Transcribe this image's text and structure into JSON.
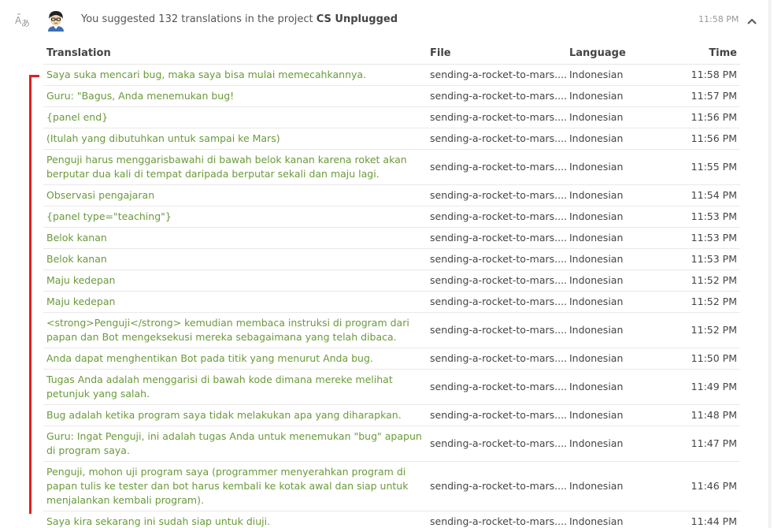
{
  "header": {
    "activity_prefix": "You suggested 132 translations in the project ",
    "project_name": "CS Unplugged",
    "time": "11:58 PM"
  },
  "icons": {
    "activity_type": "translate-icon",
    "user": "avatar-icon",
    "collapse": "chevron-up-icon"
  },
  "colors": {
    "translation_text": "#6a9a3a",
    "timeline_marker": "#e0201c"
  },
  "table": {
    "columns": {
      "translation": "Translation",
      "file": "File",
      "language": "Language",
      "time": "Time"
    },
    "rows": [
      {
        "translation": "Saya suka mencari bug, maka saya bisa mulai memecahkannya.",
        "file": "sending-a-rocket-to-mars....",
        "language": "Indonesian",
        "time": "11:58 PM",
        "lines": 1
      },
      {
        "translation": "Guru: \"Bagus, Anda menemukan bug!",
        "file": "sending-a-rocket-to-mars....",
        "language": "Indonesian",
        "time": "11:57 PM",
        "lines": 1
      },
      {
        "translation": "{panel end}",
        "file": "sending-a-rocket-to-mars....",
        "language": "Indonesian",
        "time": "11:56 PM",
        "lines": 1
      },
      {
        "translation": "(Itulah yang dibutuhkan untuk sampai ke Mars)",
        "file": "sending-a-rocket-to-mars....",
        "language": "Indonesian",
        "time": "11:56 PM",
        "lines": 1
      },
      {
        "translation": "Penguji harus menggarisbawahi di bawah belok kanan karena roket akan berputar dua kali di tempat daripada berputar sekali dan maju lagi.",
        "file": "sending-a-rocket-to-mars....",
        "language": "Indonesian",
        "time": "11:55 PM",
        "lines": 2
      },
      {
        "translation": "Observasi pengajaran",
        "file": "sending-a-rocket-to-mars....",
        "language": "Indonesian",
        "time": "11:54 PM",
        "lines": 1
      },
      {
        "translation": "{panel type=\"teaching\"}",
        "file": "sending-a-rocket-to-mars....",
        "language": "Indonesian",
        "time": "11:53 PM",
        "lines": 1
      },
      {
        "translation": "Belok kanan",
        "file": "sending-a-rocket-to-mars....",
        "language": "Indonesian",
        "time": "11:53 PM",
        "lines": 1
      },
      {
        "translation": "Belok kanan",
        "file": "sending-a-rocket-to-mars....",
        "language": "Indonesian",
        "time": "11:53 PM",
        "lines": 1
      },
      {
        "translation": "Maju kedepan",
        "file": "sending-a-rocket-to-mars....",
        "language": "Indonesian",
        "time": "11:52 PM",
        "lines": 1
      },
      {
        "translation": "Maju kedepan",
        "file": "sending-a-rocket-to-mars....",
        "language": "Indonesian",
        "time": "11:52 PM",
        "lines": 1
      },
      {
        "translation": "<strong>Penguji</strong> kemudian membaca instruksi di program dari papan dan Bot mengeksekusi mereka sebagaimana yang telah dibaca.",
        "file": "sending-a-rocket-to-mars....",
        "language": "Indonesian",
        "time": "11:52 PM",
        "lines": 2
      },
      {
        "translation": "Anda dapat menghentikan Bot pada titik yang menurut Anda bug.",
        "file": "sending-a-rocket-to-mars....",
        "language": "Indonesian",
        "time": "11:50 PM",
        "lines": 1
      },
      {
        "translation": "Tugas Anda adalah menggarisi di bawah kode dimana mereke melihat petunjuk yang salah.",
        "file": "sending-a-rocket-to-mars....",
        "language": "Indonesian",
        "time": "11:49 PM",
        "lines": 2
      },
      {
        "translation": "Bug adalah ketika program saya tidak melakukan apa yang diharapkan.",
        "file": "sending-a-rocket-to-mars....",
        "language": "Indonesian",
        "time": "11:48 PM",
        "lines": 1
      },
      {
        "translation": "Guru: Ingat Penguji, ini adalah tugas Anda untuk menemukan \"bug\" apapun di program saya.",
        "file": "sending-a-rocket-to-mars....",
        "language": "Indonesian",
        "time": "11:47 PM",
        "lines": 2
      },
      {
        "translation": "Penguji, mohon uji program saya (programmer menyerahkan program di papan tulis ke tester dan bot harus kembali ke kotak awal dan siap untuk menjalankan kembali program).",
        "file": "sending-a-rocket-to-mars....",
        "language": "Indonesian",
        "time": "11:46 PM",
        "lines": 3
      },
      {
        "translation": "Saya kira sekarang ini sudah siap untuk diuji.",
        "file": "sending-a-rocket-to-mars....",
        "language": "Indonesian",
        "time": "11:44 PM",
        "lines": 1
      }
    ]
  }
}
